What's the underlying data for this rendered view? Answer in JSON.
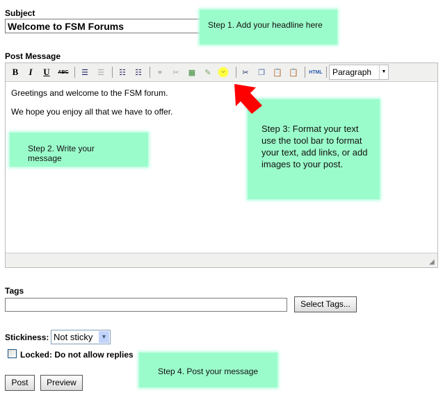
{
  "subject": {
    "label": "Subject",
    "value": "Welcome to FSM Forums"
  },
  "post_message": {
    "label": "Post Message",
    "toolbar": {
      "bold": "B",
      "italic": "I",
      "underline": "U",
      "strikethrough": "ABC",
      "html": "HTML",
      "format_select": "Paragraph"
    },
    "content": [
      "Greetings and welcome to the FSM forum.",
      "We hope you enjoy all that we have to offer."
    ]
  },
  "tags": {
    "label": "Tags",
    "value": "",
    "button": "Select Tags..."
  },
  "stickiness": {
    "label": "Stickiness:",
    "value": "Not sticky"
  },
  "locked": {
    "label": "Locked: Do not allow replies",
    "checked": false
  },
  "buttons": {
    "post": "Post",
    "preview": "Preview"
  },
  "callouts": {
    "step1": "Step 1.  Add your headline here",
    "step2": "Step 2. Write your message",
    "step3": "Step 3: Format your text use the tool bar to format your text, add links, or add images to your post.",
    "step4": "Step 4. Post your message"
  },
  "colors": {
    "callout": "#9bfccb",
    "arrow": "#ff0000"
  }
}
